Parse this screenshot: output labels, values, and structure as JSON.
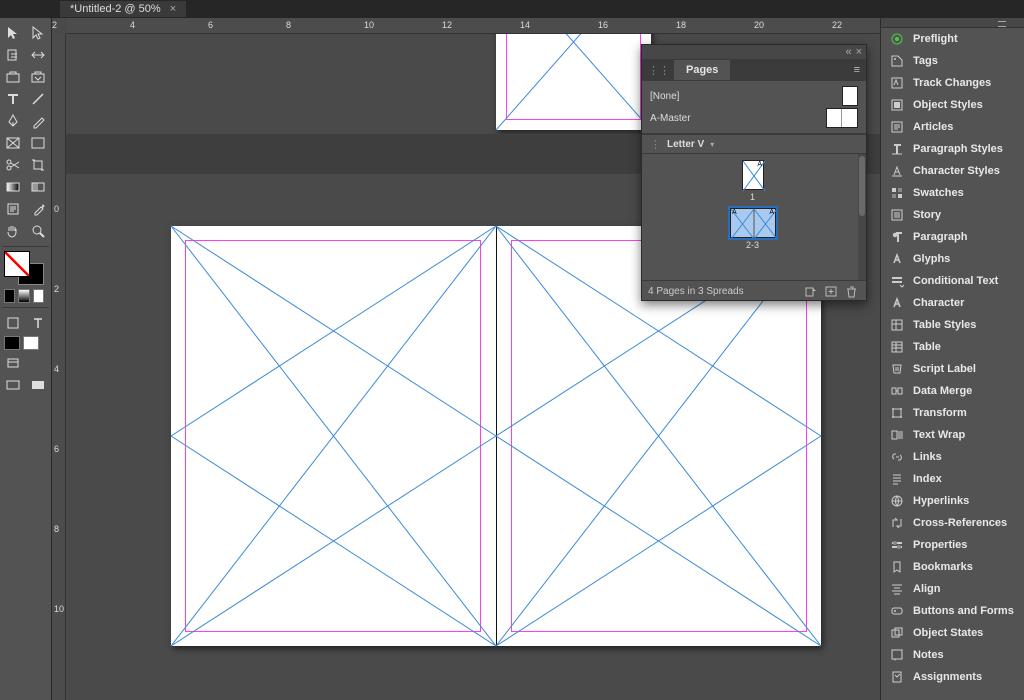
{
  "title": "*Untitled-2 @ 50%",
  "ruler": {
    "h": [
      "2",
      "4",
      "6",
      "8",
      "10",
      "12",
      "14",
      "16",
      "18",
      "20",
      "22"
    ],
    "v": [
      "0",
      "2",
      "4",
      "6",
      "8",
      "10"
    ]
  },
  "right_panels": [
    "Preflight",
    "Tags",
    "Track Changes",
    "Object Styles",
    "Articles",
    "Paragraph Styles",
    "Character Styles",
    "Swatches",
    "Story",
    "Paragraph",
    "Glyphs",
    "Conditional Text",
    "Character",
    "Table Styles",
    "Table",
    "Script Label",
    "Data Merge",
    "Transform",
    "Text Wrap",
    "Links",
    "Index",
    "Hyperlinks",
    "Cross-References",
    "Properties",
    "Bookmarks",
    "Align",
    "Buttons and Forms",
    "Object States",
    "Notes",
    "Assignments"
  ],
  "pages_panel": {
    "tab": "Pages",
    "masters": [
      {
        "name": "[None]",
        "thumb": "single"
      },
      {
        "name": "A-Master",
        "thumb": "double"
      }
    ],
    "size_label": "Letter V",
    "pages": [
      {
        "label": "1",
        "sel": false,
        "type": "single"
      },
      {
        "label": "2-3",
        "sel": true,
        "type": "double"
      }
    ],
    "status": "4 Pages in 3 Spreads"
  },
  "chart_data": {
    "type": "table",
    "note": "no chart in image"
  }
}
